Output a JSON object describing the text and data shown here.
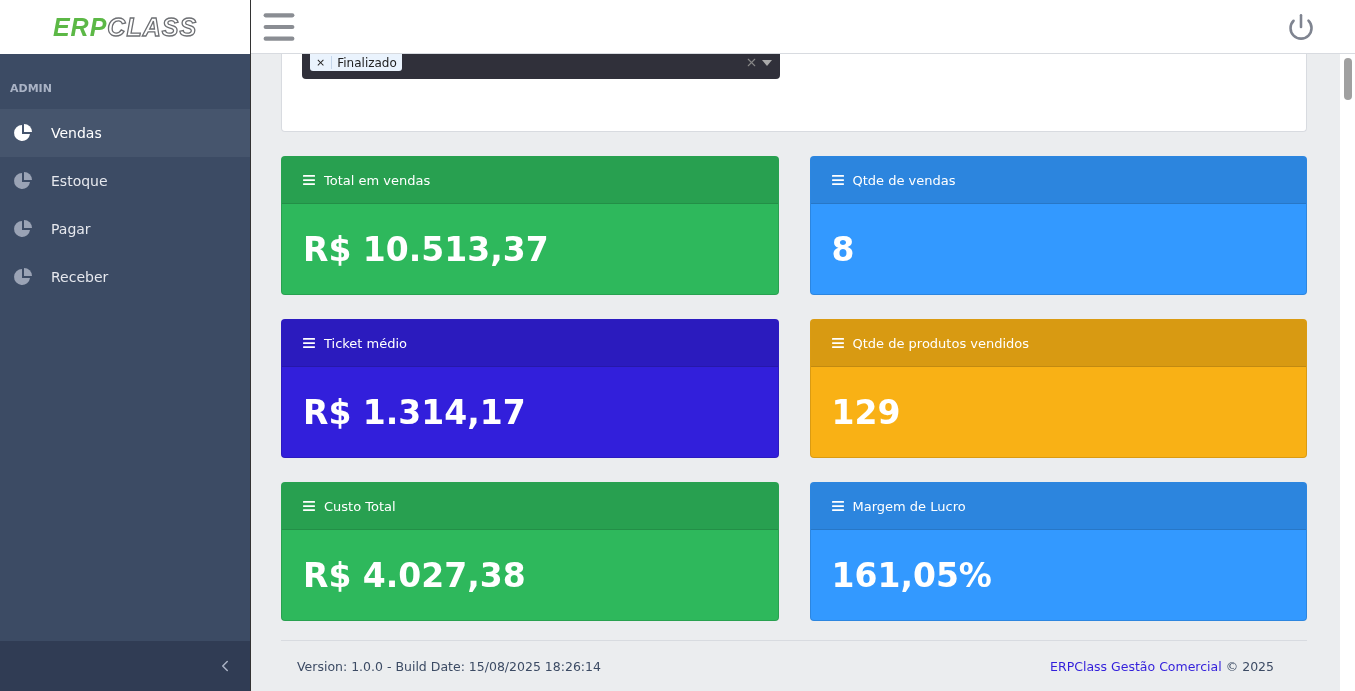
{
  "logo": {
    "first": "ERP",
    "second": "CLASS"
  },
  "sidebar": {
    "section": "ADMIN",
    "items": [
      {
        "label": "Vendas",
        "selected": true
      },
      {
        "label": "Estoque",
        "selected": false
      },
      {
        "label": "Pagar",
        "selected": false
      },
      {
        "label": "Receber",
        "selected": false
      }
    ]
  },
  "filter": {
    "tags": [
      {
        "remove": "×",
        "label": "Finalizado"
      }
    ]
  },
  "cards": [
    {
      "title": "Total em vendas",
      "value": "R$ 10.513,37",
      "color": "#2eb85c"
    },
    {
      "title": "Qtde de vendas",
      "value": "8",
      "color": "#3399ff"
    },
    {
      "title": "Ticket médio",
      "value": "R$ 1.314,17",
      "color": "#321fdb"
    },
    {
      "title": "Qtde de produtos vendidos",
      "value": "129",
      "color": "#f9b115"
    },
    {
      "title": "Custo Total",
      "value": "R$ 4.027,38",
      "color": "#2eb85c"
    },
    {
      "title": "Margem de Lucro",
      "value": "161,05%",
      "color": "#3399ff"
    }
  ],
  "footer": {
    "version": "Version: 1.0.0 - Build Date: 15/08/2025 18:26:14",
    "link": "ERPClass Gestão Comercial",
    "copyright": "© 2025"
  }
}
